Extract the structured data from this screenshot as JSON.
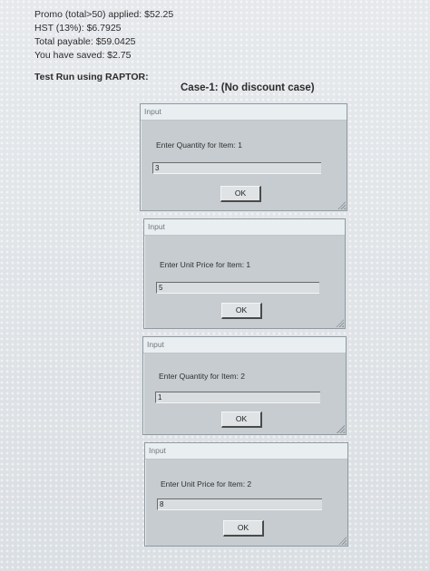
{
  "summary": {
    "promo": "Promo (total>50) applied: $52.25",
    "hst": "HST (13%): $6.7925",
    "total": "Total payable: $59.0425",
    "saved": "You have saved: $2.75"
  },
  "test_run_label": "Test Run using RAPTOR:",
  "case_title": "Case-1: (No discount case)",
  "dialogs": [
    {
      "title": "Input",
      "prompt": "Enter Quantity for Item: 1",
      "value": "3",
      "ok_label": "OK"
    },
    {
      "title": "Input",
      "prompt": "Enter Unit Price for Item: 1",
      "value": "5",
      "ok_label": "OK"
    },
    {
      "title": "Input",
      "prompt": "Enter Quantity for Item: 2",
      "value": "1",
      "ok_label": "OK"
    },
    {
      "title": "Input",
      "prompt": "Enter Unit Price for Item: 2",
      "value": "8",
      "ok_label": "OK"
    }
  ]
}
